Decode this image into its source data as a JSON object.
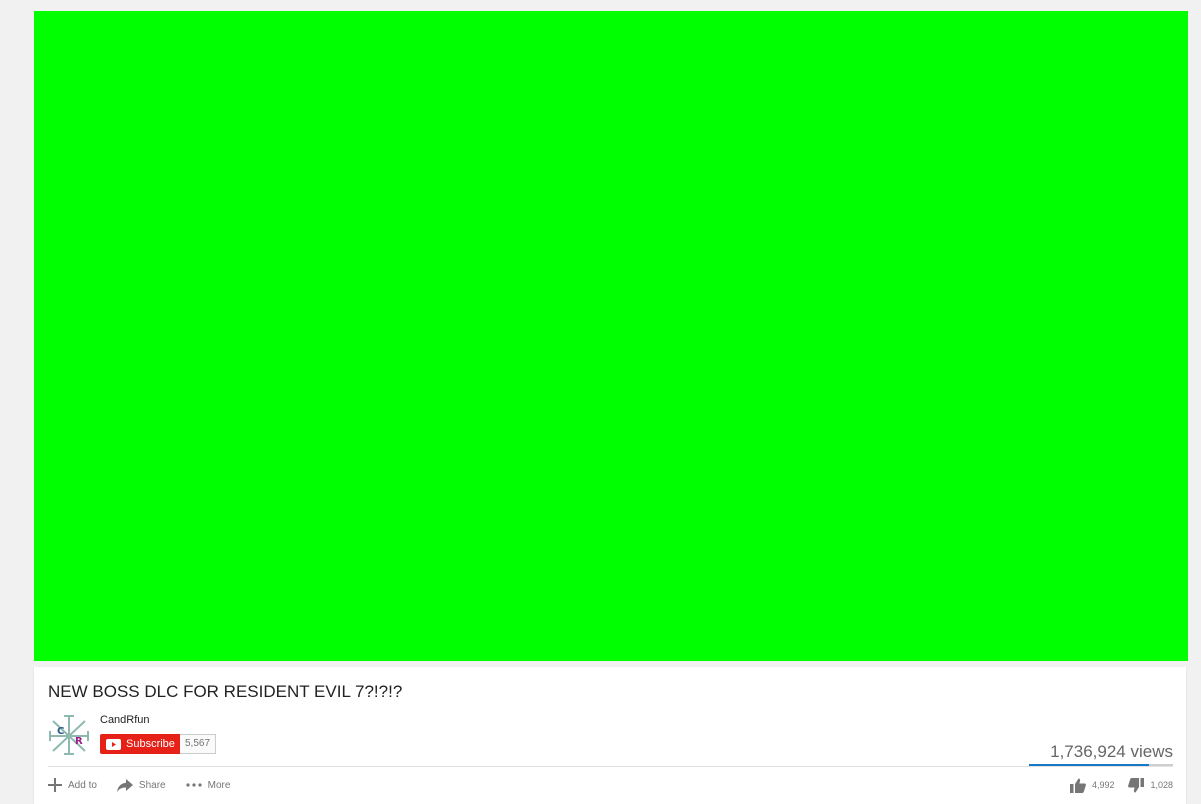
{
  "video": {
    "title": "NEW BOSS DLC FOR RESIDENT EVIL 7?!?!?",
    "player_color": "#00ff00"
  },
  "channel": {
    "name": "CandRfun",
    "subscribe_label": "Subscribe",
    "subscriber_count": "5,567"
  },
  "stats": {
    "views": "1,736,924 views",
    "likes": "4,992",
    "dislikes": "1,028",
    "like_ratio": 0.83
  },
  "actions": {
    "add_to": "Add to",
    "share": "Share",
    "more": "More"
  },
  "colors": {
    "subscribe": "#e62117",
    "like_bar": "#167ac6"
  }
}
